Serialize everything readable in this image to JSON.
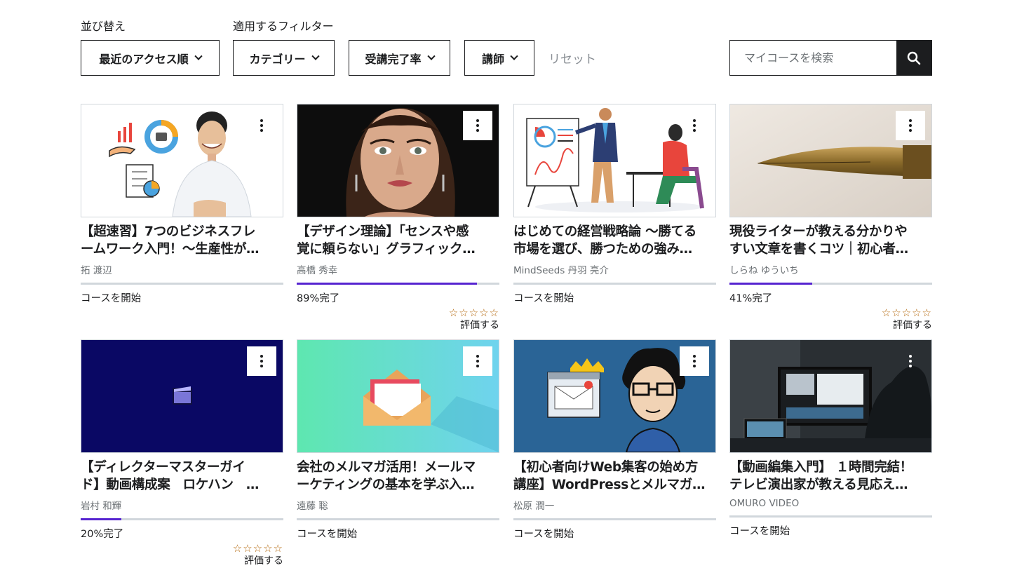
{
  "sort_label": "並び替え",
  "filter_label": "適用するフィルター",
  "filters": {
    "sort": "最近のアクセス順",
    "category": "カテゴリー",
    "completion": "受講完了率",
    "instructor": "講師",
    "reset": "リセット"
  },
  "search": {
    "placeholder": "マイコースを検索"
  },
  "rating_stars": "☆☆☆☆☆",
  "rate_label": "評価する",
  "colors": {
    "accent": "#5624d0",
    "star": "#b4690e"
  },
  "courses": [
    {
      "title1": "【超速習】7つのビジネスフレ",
      "title2": "ームワーク入門！～生産性が…",
      "instructor": "拓 渡辺",
      "status": "コースを開始",
      "progress": 0
    },
    {
      "title1": "【デザイン理論】「センスや感",
      "title2": "覚に頼らない」グラフィック…",
      "instructor": "高橋 秀幸",
      "status": "89%完了",
      "progress": 0.89
    },
    {
      "title1": "はじめての経営戦略論 ～勝てる",
      "title2": "市場を選び、勝つための強み…",
      "instructor": "MindSeeds 丹羽 亮介",
      "status": "コースを開始",
      "progress": 0
    },
    {
      "title1": "現役ライターが教える分かりや",
      "title2": "すい文章を書くコツ｜初心者…",
      "instructor": "しらね ゆういち",
      "status": "41%完了",
      "progress": 0.41
    },
    {
      "title1": "【ディレクターマスターガイ",
      "title2": "ド】動画構成案　ロケハン　…",
      "instructor": "岩村 和輝",
      "status": "20%完了",
      "progress": 0.2
    },
    {
      "title1": "会社のメルマガ活用！メールマ",
      "title2": "ーケティングの基本を学ぶ入…",
      "instructor": "遠藤 聡",
      "status": "コースを開始",
      "progress": 0
    },
    {
      "title1": "【初心者向けWeb集客の始め方",
      "title2": "講座】WordPressとメルマガ…",
      "instructor": "松原 潤一",
      "status": "コースを開始",
      "progress": 0
    },
    {
      "title1": "【動画編集入門】 １時間完結！",
      "title2": "テレビ演出家が教える見応え…",
      "instructor": "OMURO VIDEO",
      "status": "コースを開始",
      "progress": 0
    }
  ]
}
